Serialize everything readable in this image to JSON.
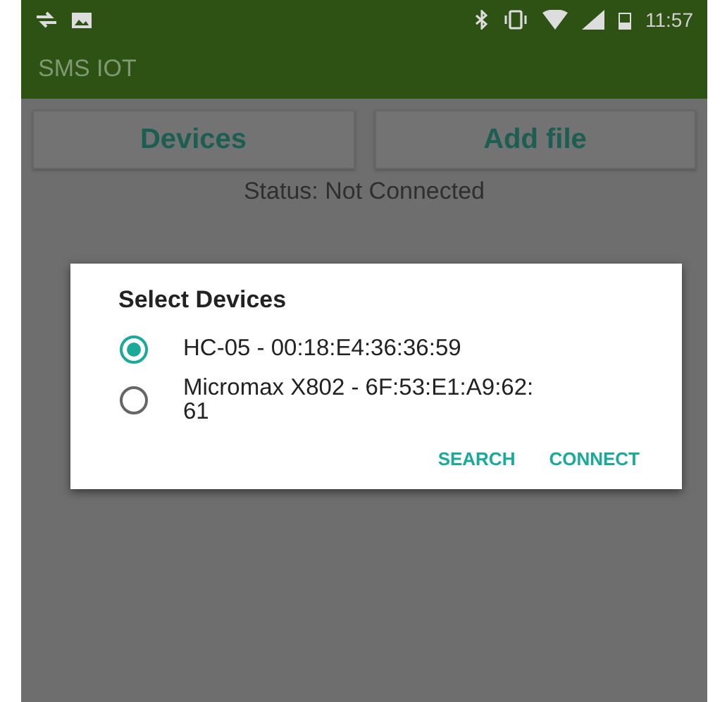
{
  "status_bar": {
    "time": "11:57"
  },
  "toolbar": {
    "title": "SMS IOT"
  },
  "buttons": [
    "Devices",
    "Add file"
  ],
  "status_text": "Status: Not Connected",
  "dialog": {
    "title": "Select Devices",
    "devices": [
      {
        "label": "HC-05 - 00:18:E4:36:36:59",
        "selected": true
      },
      {
        "label": "Micromax X802 - 6F:53:E1:A9:62:61",
        "selected": false
      }
    ],
    "actions": [
      "SEARCH",
      "CONNECT"
    ]
  }
}
